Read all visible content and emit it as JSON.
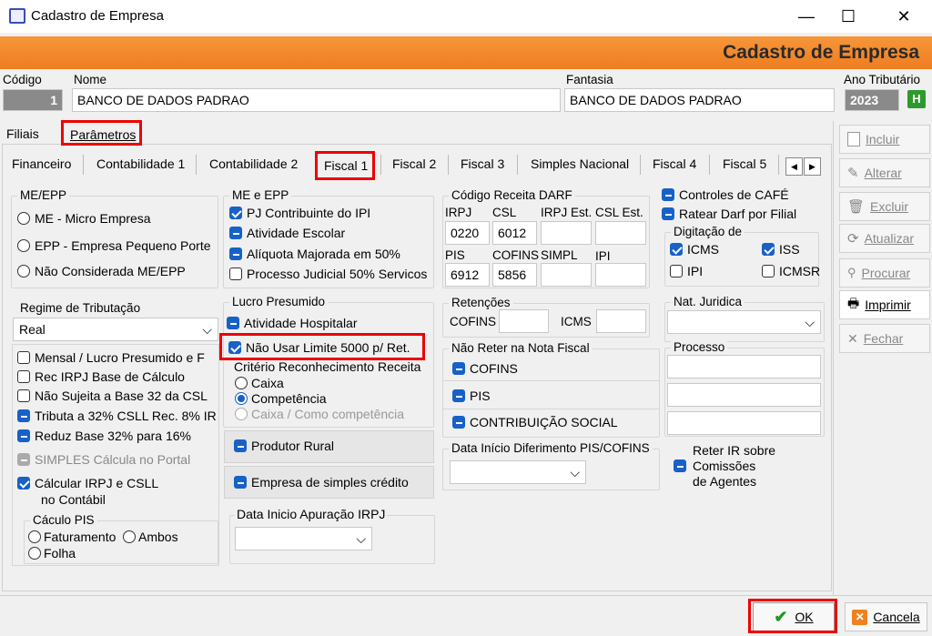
{
  "window": {
    "title": "Cadastro de Empresa",
    "minimize": "—",
    "maximize": "☐",
    "close": "✕"
  },
  "banner": {
    "title": "Cadastro de Empresa"
  },
  "header": {
    "codigo_label": "Código",
    "codigo_value": "1",
    "nome_label": "Nome",
    "nome_value": "BANCO DE DADOS PADRAO",
    "fantasia_label": "Fantasia",
    "fantasia_value": "BANCO DE DADOS PADRAO",
    "ano_label": "Ano Tributário",
    "ano_value": "2023",
    "ano_btn": "H"
  },
  "tabs_top": [
    "Filiais",
    "Parâmetros"
  ],
  "tabs_sub": [
    "Financeiro",
    "Contabilidade 1",
    "Contabilidade 2",
    "Fiscal 1",
    "Fiscal 2",
    "Fiscal 3",
    "Simples Nacional",
    "Fiscal 4",
    "Fiscal 5"
  ],
  "me_epp": {
    "title": "ME/EPP",
    "options": [
      "ME - Micro Empresa",
      "EPP - Empresa Pequeno Porte",
      "Não Considerada ME/EPP"
    ]
  },
  "me_e_epp": {
    "title": "ME e EPP",
    "items": [
      "PJ Contribuinte do IPI",
      "Atividade Escolar",
      "Alíquota Majorada em 50%",
      "Processo Judicial 50% Servicos"
    ]
  },
  "darf": {
    "title": "Código Receita DARF",
    "irpj": "IRPJ",
    "csl": "CSL",
    "irpj_est": "IRPJ Est.",
    "csl_est": "CSL Est.",
    "irpj_val": "0220",
    "csl_val": "6012",
    "pis": "PIS",
    "cofins": "COFINS",
    "simpl": "SIMPL",
    "ipi": "IPI",
    "pis_val": "6912",
    "cofins_val": "5856"
  },
  "right_checks": {
    "cafe": "Controles de CAFÉ",
    "ratear": "Ratear Darf por Filial"
  },
  "digitacao": {
    "title": "Digitação de",
    "icms": "ICMS",
    "iss": "ISS",
    "ipi": "IPI",
    "icmsr": "ICMSR"
  },
  "regime": {
    "title": "Regime de Tributação",
    "value": "Real",
    "items": [
      "Mensal / Lucro Presumido e F",
      "Rec IRPJ Base de Cálculo",
      "Não Sujeita a Base 32 da CSL",
      "Tributa a 32% CSLL Rec. 8% IR",
      "Reduz Base 32% para 16%",
      "SIMPLES Cálcula  no Portal",
      "Cálcular IRPJ e CSLL",
      "no Contábil"
    ]
  },
  "calculo_pis": {
    "title": "Cáculo PIS",
    "faturamento": "Faturamento",
    "ambos": "Ambos",
    "folha": "Folha"
  },
  "lucro": {
    "title": "Lucro Presumido",
    "hospitalar": "Atividade Hospitalar",
    "nao_usar": "Não Usar Limite 5000 p/ Ret.",
    "criterio": "Critério Reconhecimento  Receita",
    "caixa": "Caixa",
    "competencia": "Competência",
    "caixa_comp": "Caixa / Como competência"
  },
  "produtor": "Produtor Rural",
  "simples_credito": "Empresa de simples crédito",
  "data_irpj": {
    "title": "Data Inicio Apuração IRPJ"
  },
  "retencoes": {
    "title": "Retenções",
    "cofins": "COFINS",
    "icms": "ICMS"
  },
  "nao_reter": {
    "title": "Não Reter na Nota Fiscal",
    "items": [
      "COFINS",
      "PIS",
      "CONTRIBUIÇÃO SOCIAL"
    ]
  },
  "data_diferimento": {
    "title": "Data Início Diferimento PIS/COFINS"
  },
  "nat_juridica": {
    "title": "Nat. Juridica"
  },
  "processo": {
    "title": "Processo"
  },
  "reter_ir": {
    "l1": "Reter IR sobre",
    "l2": "Comissões",
    "l3": "de Agentes"
  },
  "side_buttons": [
    "Incluir",
    "Alterar",
    "Excluir",
    "Atualizar",
    "Procurar",
    "Imprimir",
    "Fechar"
  ],
  "footer": {
    "ok": "OK",
    "cancel": "Cancela"
  }
}
